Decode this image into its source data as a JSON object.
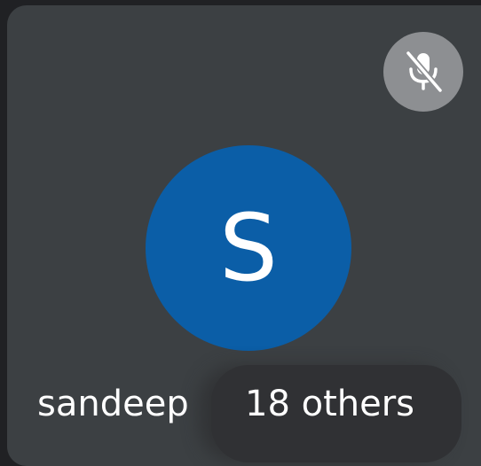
{
  "tile": {
    "muted_icon": "mic-off-icon",
    "avatar_initial": "S",
    "avatar_color": "#0b5ea7",
    "participant_name": "sandeep",
    "others_label": "18 others"
  }
}
